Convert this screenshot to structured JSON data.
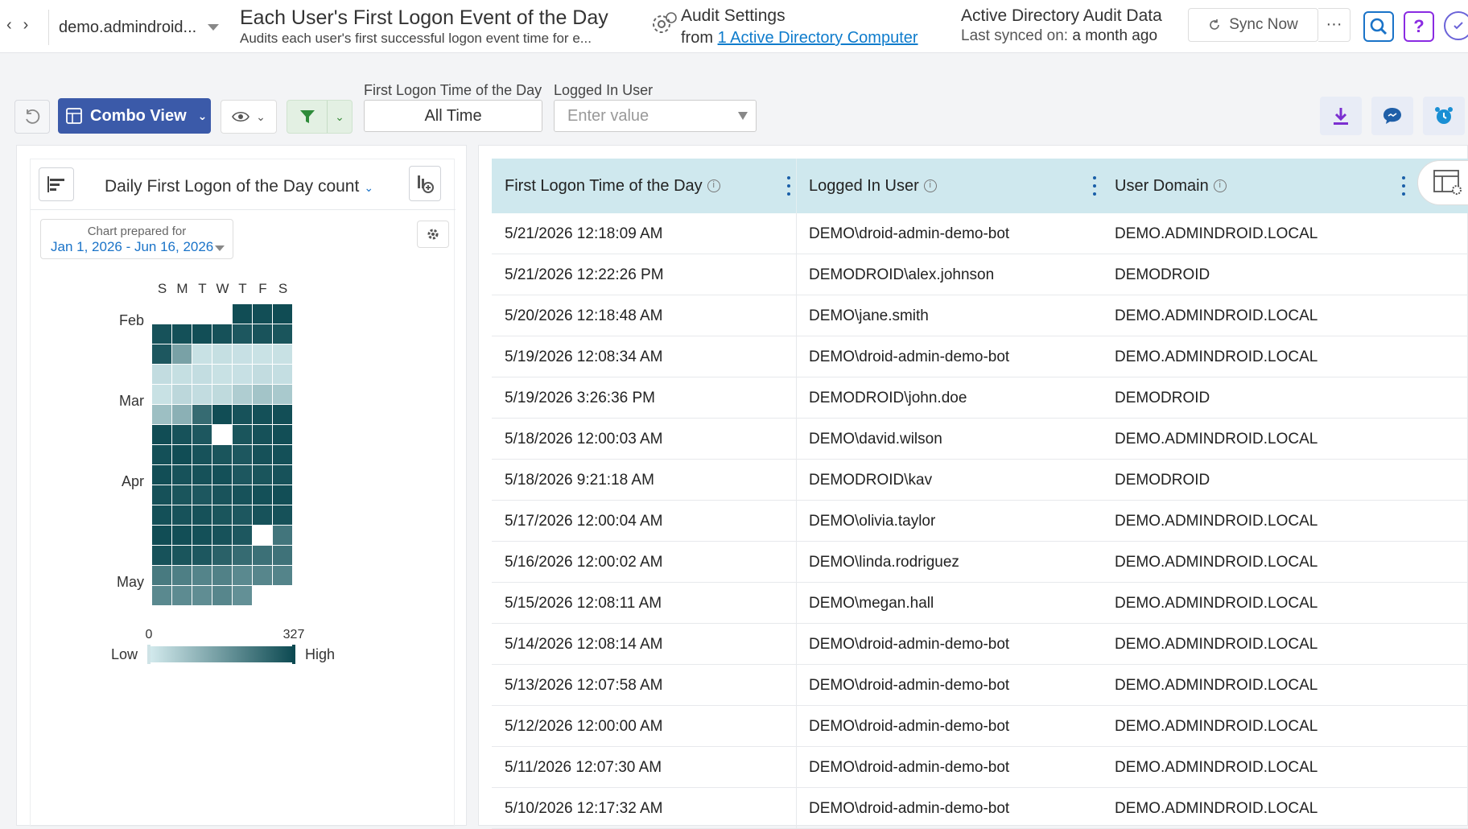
{
  "topbar": {
    "tenant": "demo.admindroid...",
    "report_title": "Each User's First Logon Event of the Day",
    "report_subtitle": "Audits each user's first successful logon event time for e...",
    "audit_title": "Audit Settings",
    "audit_from": "from",
    "audit_link": "1 Active Directory Computer",
    "ad_title": "Active Directory Audit Data",
    "last_synced_label": "Last synced on:",
    "last_synced_value": "a month ago",
    "sync_label": "Sync Now",
    "more_label": "···",
    "help_label": "?"
  },
  "toolbar": {
    "combo_label": "Combo View",
    "filter_time_label": "First Logon Time of the Day",
    "filter_time_value": "All Time",
    "filter_user_label": "Logged In User",
    "filter_user_placeholder": "Enter value"
  },
  "chart_panel": {
    "title": "Daily First Logon of the Day count",
    "prepared_label": "Chart prepared for",
    "prepared_range": "Jan 1, 2026 - Jun 16, 2026"
  },
  "chart_data": {
    "type": "heatmap",
    "title": "Daily First Logon of the Day count",
    "weekdays": [
      "S",
      "M",
      "T",
      "W",
      "T",
      "F",
      "S"
    ],
    "month_labels": [
      {
        "label": "Feb",
        "week": 0
      },
      {
        "label": "Mar",
        "week": 4
      },
      {
        "label": "Apr",
        "week": 8
      },
      {
        "label": "May",
        "week": 13
      }
    ],
    "legend": {
      "min": 0,
      "max": 327,
      "low_label": "Low",
      "high_label": "High"
    },
    "colors": {
      "low": "#d4ebee",
      "high": "#0d4a52"
    },
    "weeks": [
      [
        null,
        null,
        null,
        null,
        320,
        318,
        322
      ],
      [
        310,
        315,
        318,
        312,
        300,
        308,
        305
      ],
      [
        300,
        150,
        20,
        25,
        22,
        18,
        20
      ],
      [
        30,
        25,
        28,
        20,
        22,
        30,
        26
      ],
      [
        20,
        40,
        30,
        35,
        60,
        80,
        70
      ],
      [
        90,
        120,
        260,
        320,
        310,
        315,
        318
      ],
      [
        320,
        310,
        300,
        null,
        305,
        312,
        318
      ],
      [
        315,
        320,
        310,
        305,
        300,
        312,
        315
      ],
      [
        318,
        310,
        312,
        315,
        300,
        305,
        310
      ],
      [
        312,
        305,
        300,
        308,
        310,
        315,
        318
      ],
      [
        315,
        310,
        312,
        305,
        300,
        310,
        312
      ],
      [
        320,
        318,
        315,
        310,
        300,
        null,
        240
      ],
      [
        310,
        305,
        300,
        280,
        260,
        250,
        245
      ],
      [
        230,
        220,
        210,
        215,
        200,
        205,
        210
      ],
      [
        200,
        195,
        190,
        205,
        185,
        null,
        null
      ]
    ]
  },
  "table": {
    "columns": [
      "First Logon Time of the Day",
      "Logged In User",
      "User Domain"
    ],
    "rows": [
      [
        "5/21/2026 12:18:09 AM",
        "DEMO\\droid-admin-demo-bot",
        "DEMO.ADMINDROID.LOCAL"
      ],
      [
        "5/21/2026 12:22:26 PM",
        "DEMODROID\\alex.johnson",
        "DEMODROID"
      ],
      [
        "5/20/2026 12:18:48 AM",
        "DEMO\\jane.smith",
        "DEMO.ADMINDROID.LOCAL"
      ],
      [
        "5/19/2026 12:08:34 AM",
        "DEMO\\droid-admin-demo-bot",
        "DEMO.ADMINDROID.LOCAL"
      ],
      [
        "5/19/2026 3:26:36 PM",
        "DEMODROID\\john.doe",
        "DEMODROID"
      ],
      [
        "5/18/2026 12:00:03 AM",
        "DEMO\\david.wilson",
        "DEMO.ADMINDROID.LOCAL"
      ],
      [
        "5/18/2026 9:21:18 AM",
        "DEMODROID\\kav",
        "DEMODROID"
      ],
      [
        "5/17/2026 12:00:04 AM",
        "DEMO\\olivia.taylor",
        "DEMO.ADMINDROID.LOCAL"
      ],
      [
        "5/16/2026 12:00:02 AM",
        "DEMO\\linda.rodriguez",
        "DEMO.ADMINDROID.LOCAL"
      ],
      [
        "5/15/2026 12:08:11 AM",
        "DEMO\\megan.hall",
        "DEMO.ADMINDROID.LOCAL"
      ],
      [
        "5/14/2026 12:08:14 AM",
        "DEMO\\droid-admin-demo-bot",
        "DEMO.ADMINDROID.LOCAL"
      ],
      [
        "5/13/2026 12:07:58 AM",
        "DEMO\\droid-admin-demo-bot",
        "DEMO.ADMINDROID.LOCAL"
      ],
      [
        "5/12/2026 12:00:00 AM",
        "DEMO\\droid-admin-demo-bot",
        "DEMO.ADMINDROID.LOCAL"
      ],
      [
        "5/11/2026 12:07:30 AM",
        "DEMO\\droid-admin-demo-bot",
        "DEMO.ADMINDROID.LOCAL"
      ],
      [
        "5/10/2026 12:17:32 AM",
        "DEMO\\droid-admin-demo-bot",
        "DEMO.ADMINDROID.LOCAL"
      ]
    ]
  }
}
